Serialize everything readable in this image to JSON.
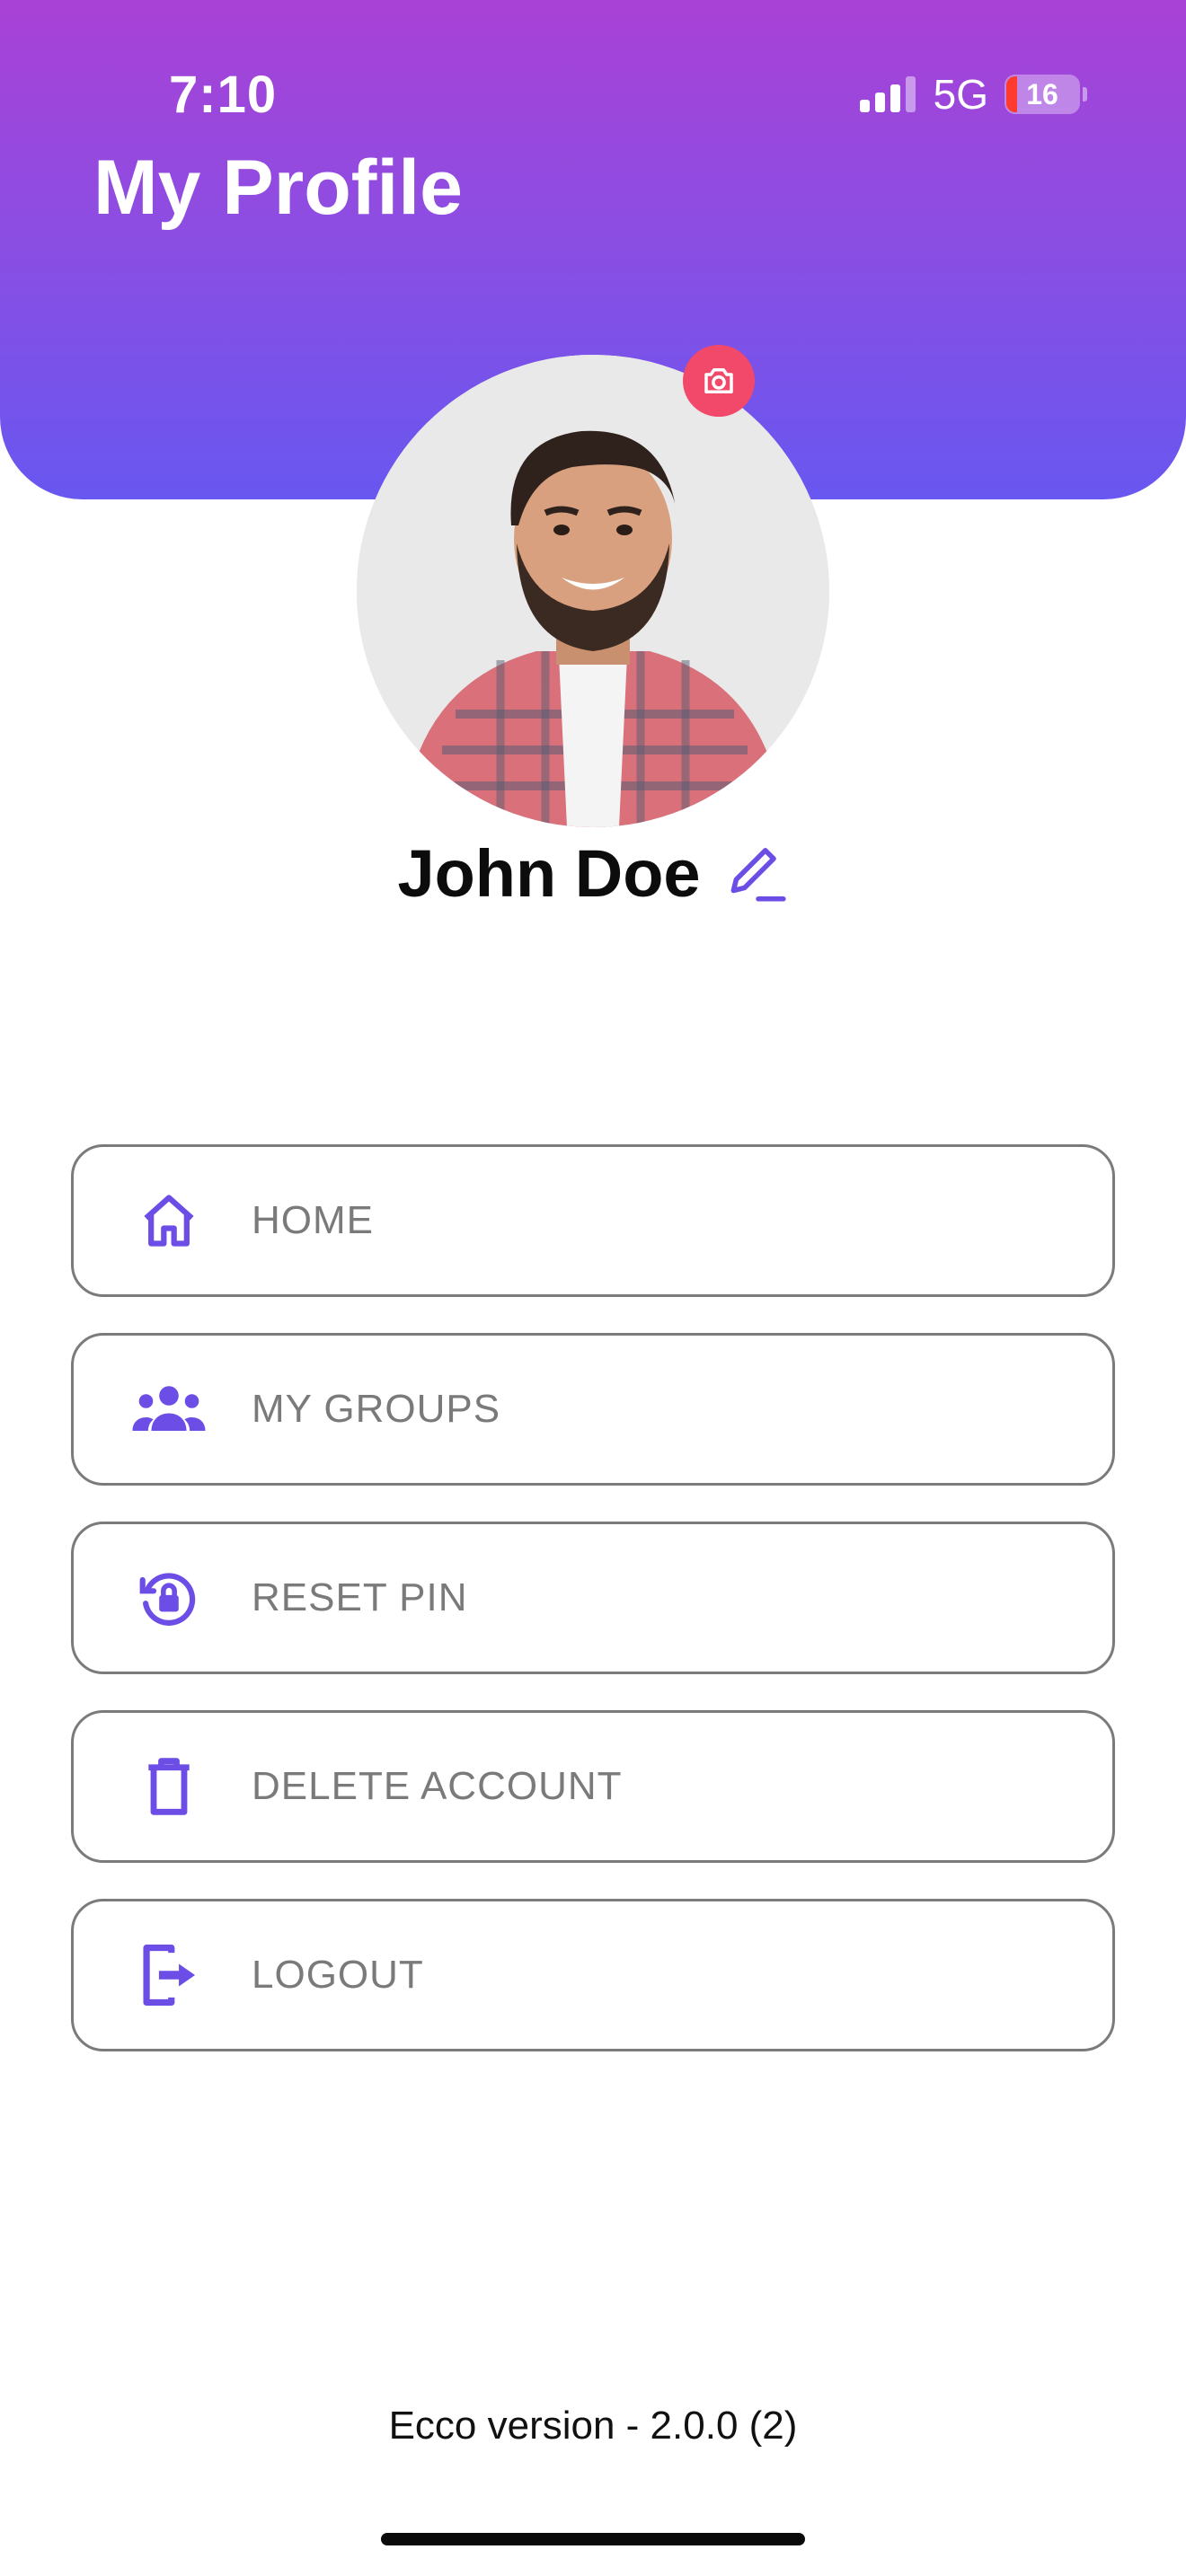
{
  "status_bar": {
    "time": "7:10",
    "network": "5G",
    "battery": "16"
  },
  "header": {
    "title": "My Profile"
  },
  "profile": {
    "name": "John Doe"
  },
  "menu": {
    "items": [
      {
        "label": "HOME",
        "icon": "home-icon"
      },
      {
        "label": "MY GROUPS",
        "icon": "groups-icon"
      },
      {
        "label": "RESET PIN",
        "icon": "reset-pin-icon"
      },
      {
        "label": "DELETE ACCOUNT",
        "icon": "trash-icon"
      },
      {
        "label": "LOGOUT",
        "icon": "logout-icon"
      }
    ]
  },
  "footer": {
    "version": "Ecco version - 2.0.0 (2)"
  },
  "colors": {
    "accent": "#6c4ee6",
    "header_top": "#a941d6",
    "header_bottom": "#6857f0",
    "camera_badge": "#f2496a"
  }
}
